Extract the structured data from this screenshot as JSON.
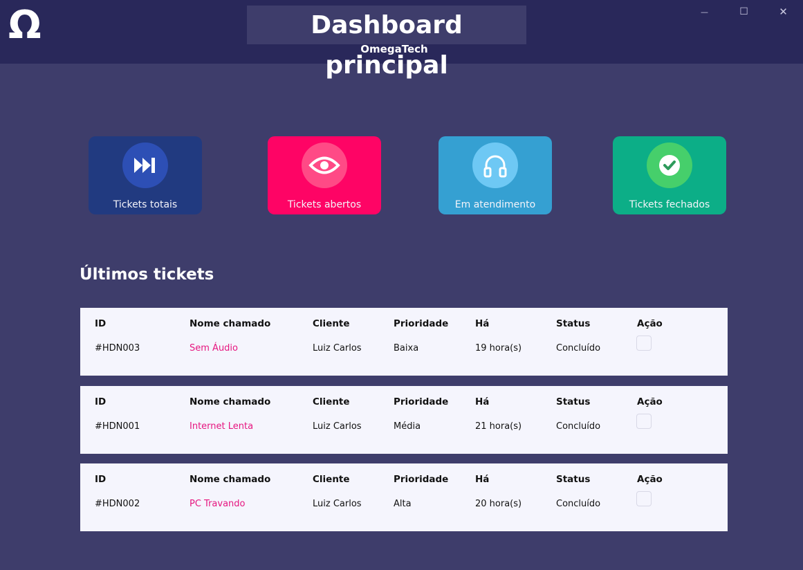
{
  "header": {
    "logo_glyph": "Ω",
    "title": "Dashboard principal",
    "subtitle": "OmegaTech",
    "window_controls": {
      "minimize": "—",
      "maximize": "☐",
      "close": "✕"
    }
  },
  "cards": [
    {
      "label": "Tickets totais",
      "icon": "fast-forward-icon",
      "color": "#213a80",
      "circle": "#2d4fb5"
    },
    {
      "label": "Tickets abertos",
      "icon": "eye-icon",
      "color": "#fe0465",
      "circle": "#ff4a86"
    },
    {
      "label": "Em atendimento",
      "icon": "headphones-icon",
      "color": "#35a0d2",
      "circle": "#6ec8f4"
    },
    {
      "label": "Tickets fechados",
      "icon": "check-circle-icon",
      "color": "#0cae87",
      "circle": "#46cf6b"
    }
  ],
  "section": {
    "title": "Últimos tickets"
  },
  "table_headers": {
    "id": "ID",
    "name": "Nome chamado",
    "client": "Cliente",
    "priority": "Prioridade",
    "ago": "Há",
    "status": "Status",
    "action": "Ação"
  },
  "tickets": [
    {
      "id": "#HDN003",
      "name": "Sem Áudio",
      "client": "Luiz Carlos",
      "priority": "Baixa",
      "ago": "19 hora(s)",
      "status": "Concluído"
    },
    {
      "id": "#HDN001",
      "name": "Internet Lenta",
      "client": "Luiz Carlos",
      "priority": "Média",
      "ago": "21 hora(s)",
      "status": "Concluído"
    },
    {
      "id": "#HDN002",
      "name": "PC Travando",
      "client": "Luiz Carlos",
      "priority": "Alta",
      "ago": "20 hora(s)",
      "status": "Concluído"
    }
  ]
}
